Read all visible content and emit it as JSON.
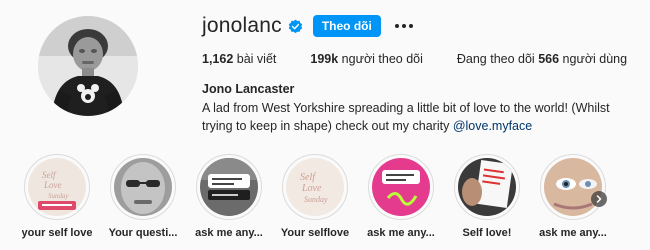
{
  "profile": {
    "username": "jonolanc",
    "follow_label": "Theo dõi",
    "more_icon": "more-options-icon",
    "verified_color": "#0095f6",
    "full_name": "Jono Lancaster",
    "bio_text": "A lad from West Yorkshire spreading a little bit of love to the world! (Whilst trying to keep in shape) check out my charity",
    "bio_mention": "@love.myface"
  },
  "stats": {
    "posts_count": "1,162",
    "posts_label": "bài viết",
    "followers_count": "199k",
    "followers_label": "người theo dõi",
    "following_prefix": "Đang theo dõi",
    "following_count": "566",
    "following_label": "người dùng"
  },
  "highlights": [
    {
      "label": "your self love",
      "icon": "self-love-card-thumbnail"
    },
    {
      "label": "Your questi...",
      "icon": "face-photo-thumbnail"
    },
    {
      "label": "ask me any...",
      "icon": "question-sticker-thumbnail"
    },
    {
      "label": "Your selflove",
      "icon": "self-love-card-thumbnail"
    },
    {
      "label": "ask me any...",
      "icon": "pink-question-thumbnail"
    },
    {
      "label": "Self love!",
      "icon": "notes-photo-thumbnail"
    },
    {
      "label": "ask me any...",
      "icon": "face-closeup-thumbnail"
    }
  ],
  "controls": {
    "next_icon": "chevron-right-icon"
  },
  "colors": {
    "accent": "#0095f6",
    "text": "#262626",
    "link": "#00376b",
    "background": "#fafafa"
  }
}
